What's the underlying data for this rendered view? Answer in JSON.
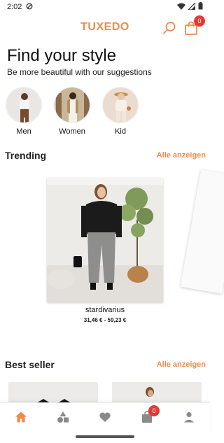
{
  "status_bar": {
    "time": "2:02"
  },
  "header": {
    "title": "TUXEDO",
    "cart_count": "0"
  },
  "hero": {
    "title": "Find your style",
    "subtitle": "Be more beautiful with our suggestions"
  },
  "categories": [
    {
      "label": "Men"
    },
    {
      "label": "Women"
    },
    {
      "label": "Kid"
    }
  ],
  "trending": {
    "title": "Trending",
    "see_all": "Alle anzeigen",
    "product": {
      "name": "stardivarius",
      "price": "31,46 € - 59,23 €"
    }
  },
  "best_seller": {
    "title": "Best seller",
    "see_all": "Alle anzeigen"
  },
  "bottom_nav": {
    "items": [
      "home",
      "categories",
      "favorites",
      "cart",
      "profile"
    ],
    "cart_count": "0"
  },
  "colors": {
    "accent": "#f08a4b",
    "badge": "#e53935",
    "icon_gray": "#8a8a8a"
  }
}
